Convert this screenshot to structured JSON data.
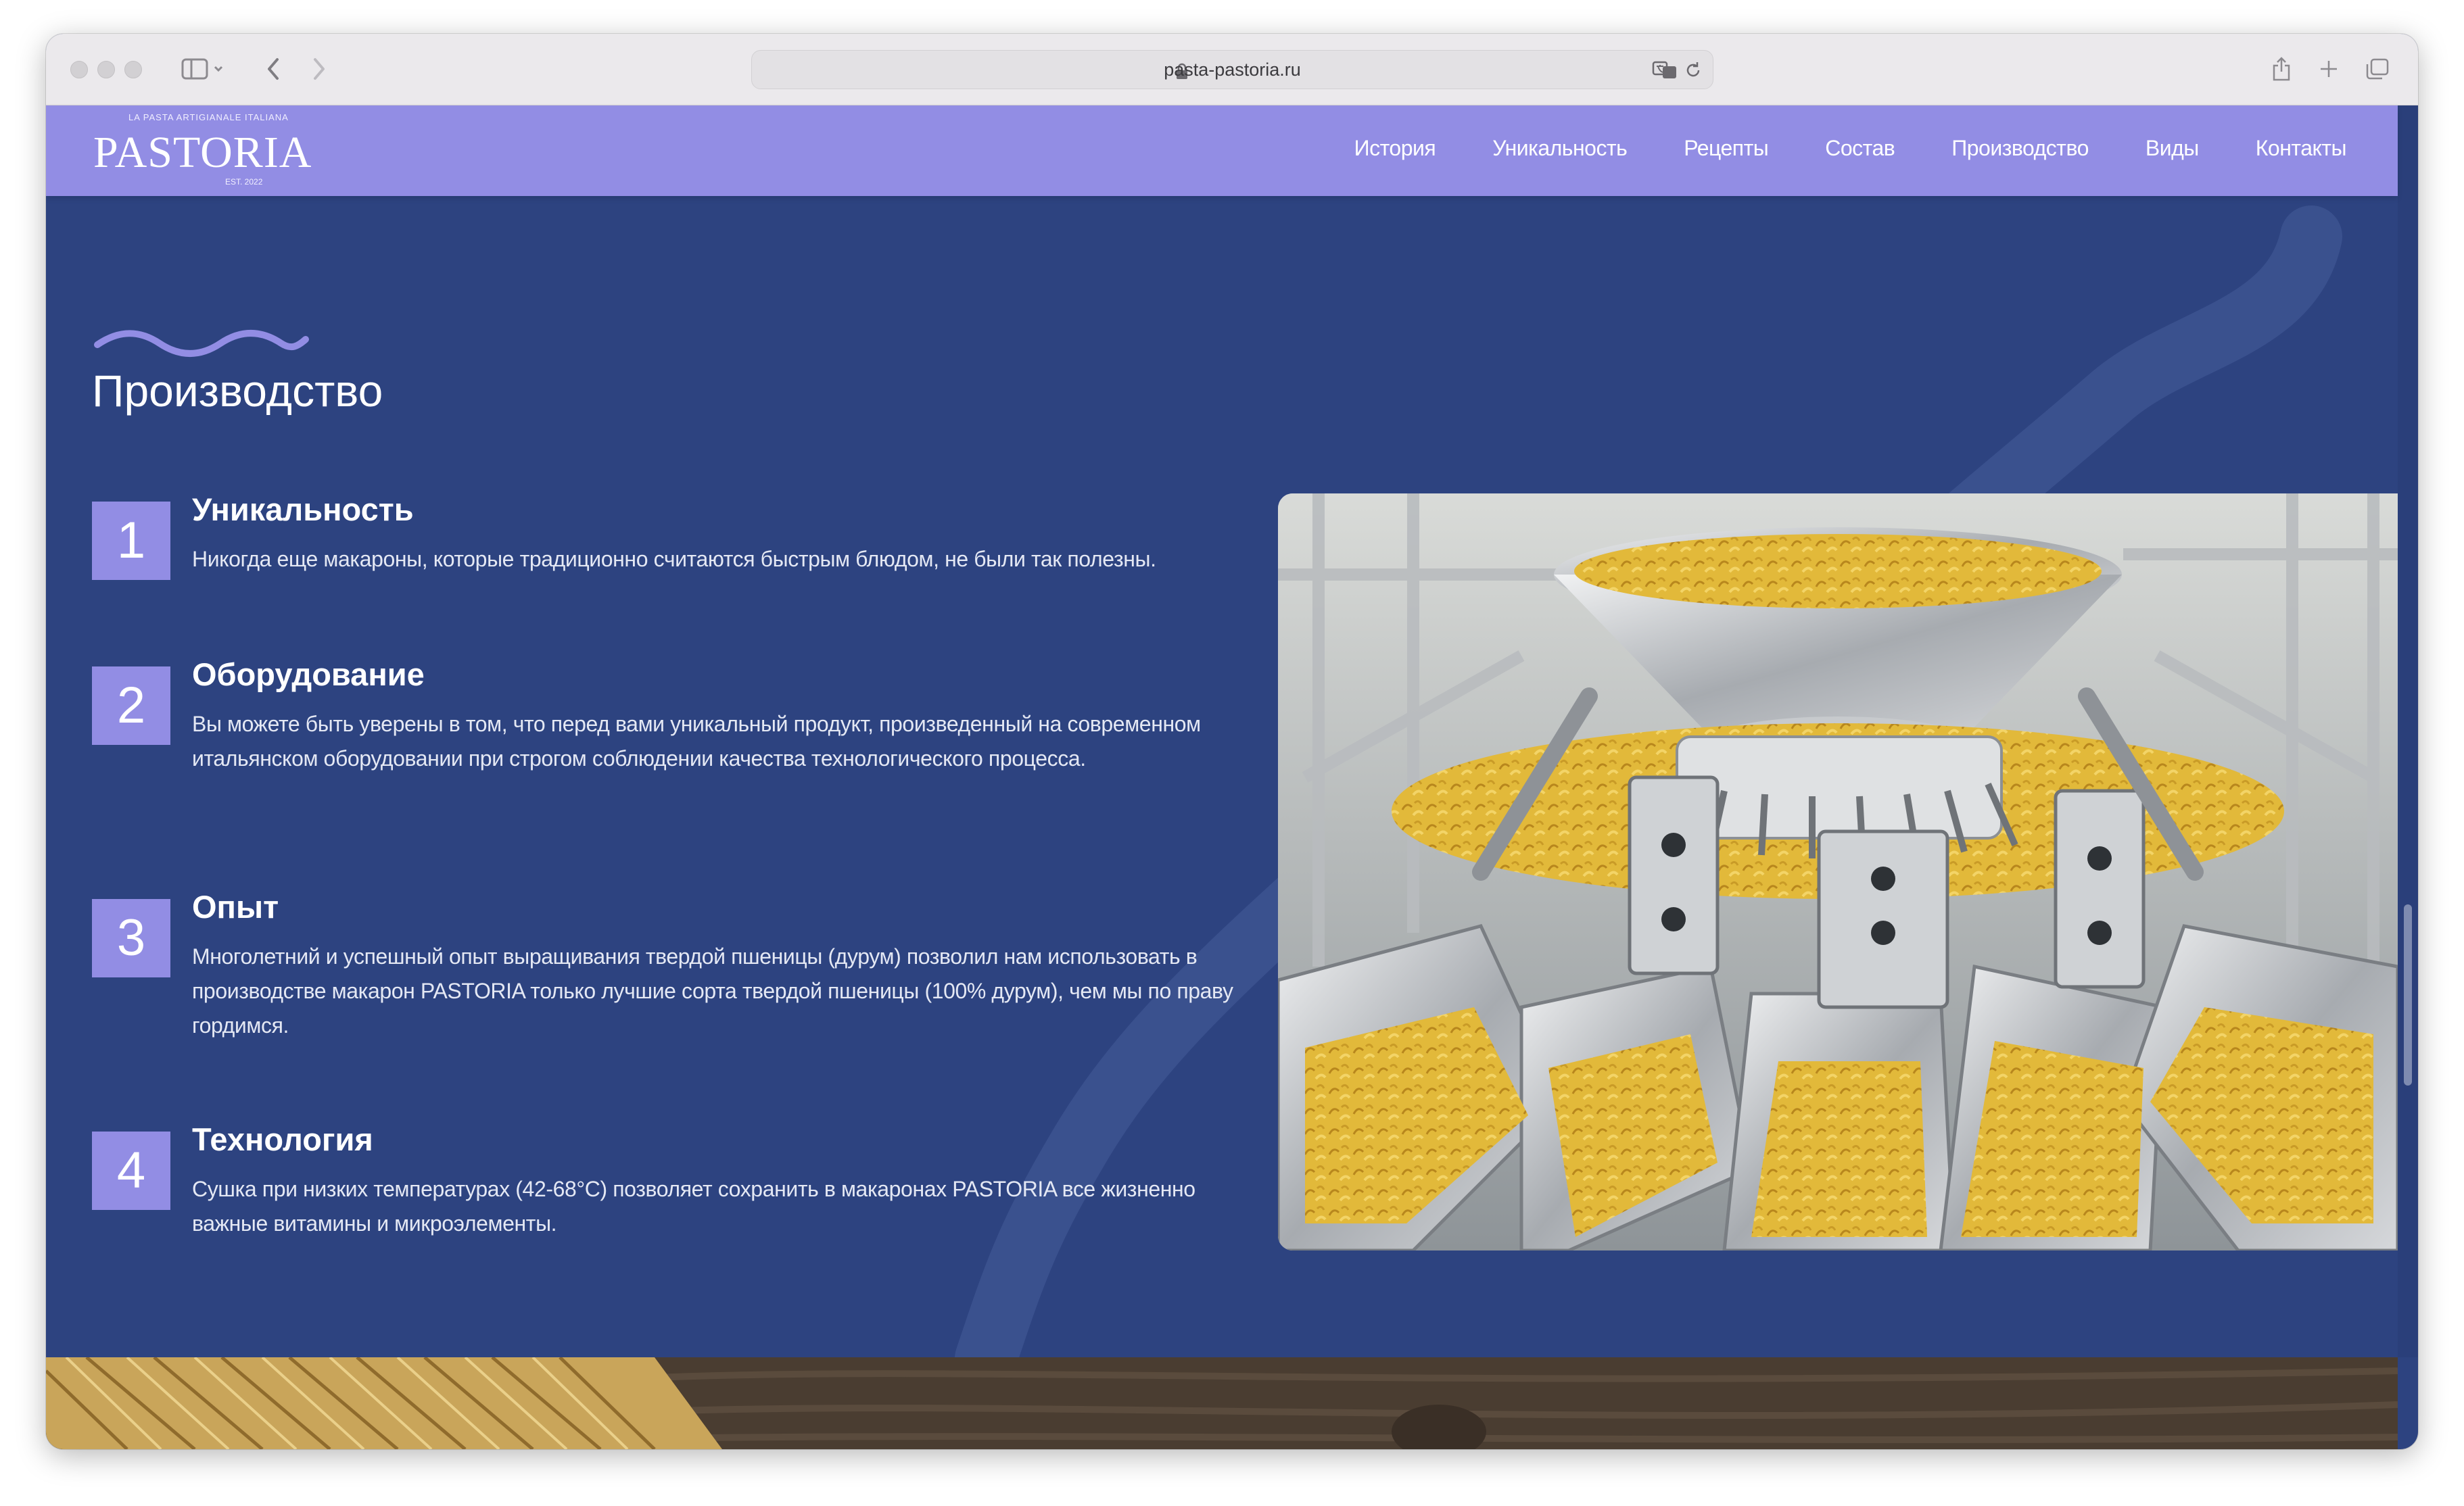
{
  "browser": {
    "url": "pasta-pastoria.ru"
  },
  "site": {
    "logo": {
      "tagline": "LA PASTA ARTIGIANALE ITALIANA",
      "wordmark": "PASTORIA",
      "est": "EST. 2022"
    },
    "nav": [
      "История",
      "Уникальность",
      "Рецепты",
      "Состав",
      "Производство",
      "Виды",
      "Контакты"
    ]
  },
  "section": {
    "title": "Производство",
    "items": [
      {
        "number": "1",
        "heading": "Уникальность",
        "text": "Никогда еще макароны, которые традиционно считаются быстрым блюдом, не были так полезны."
      },
      {
        "number": "2",
        "heading": "Оборудование",
        "text": "Вы можете быть уверены в том, что перед вами уникальный продукт, произведенный на современном итальянском оборудовании при строгом соблюдении качества технологического процесса."
      },
      {
        "number": "3",
        "heading": "Опыт",
        "text": "Многолетний и успешный опыт выращивания твердой пшеницы (дурум) позволил нам использовать в производстве макарон PASTORIA только лучшие сорта твердой пшеницы (100% дурум), чем мы по праву гордимся."
      },
      {
        "number": "4",
        "heading": "Технология",
        "text": "Сушка при низких температурах (42-68°С) позволяет сохранить в макаронах PASTORIA все жизненно важные витамины и микроэлементы."
      }
    ],
    "image_alt": "pasta-weighing-machine-photo"
  },
  "colors": {
    "section_bg": "#2d4380",
    "header_bg": "#928de4",
    "accent": "#928de4",
    "text": "#ffffff"
  }
}
